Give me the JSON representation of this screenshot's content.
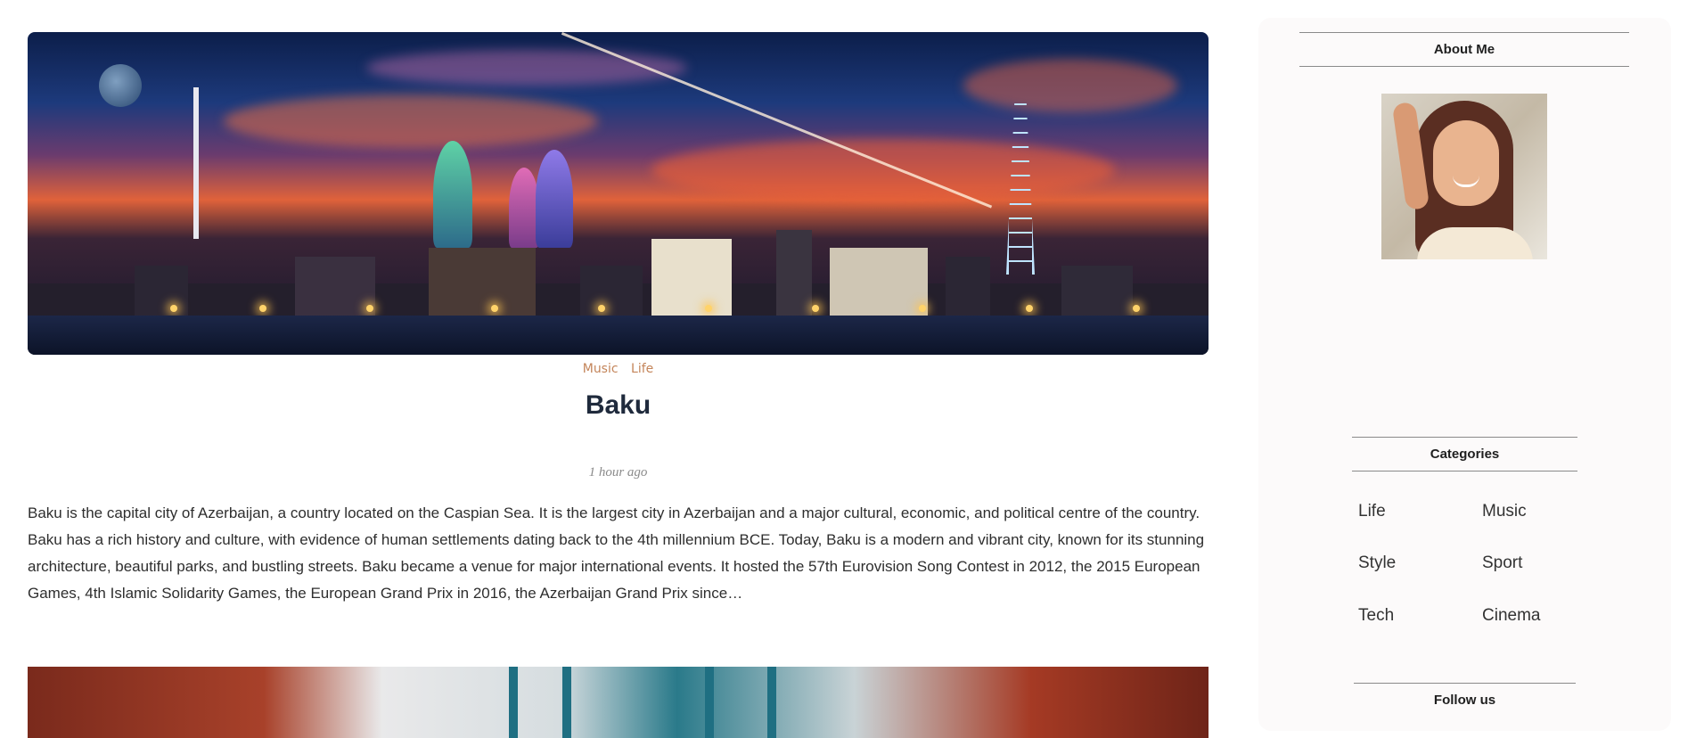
{
  "post": {
    "tags": [
      "Music",
      "Life"
    ],
    "title": "Baku",
    "time": "1 hour ago",
    "excerpt": "Baku is the capital city of Azerbaijan, a country located on the Caspian Sea. It is the largest city in Azerbaijan and a major cultural, economic, and political centre of the country. Baku has a rich history and culture, with evidence of human settlements dating back to the 4th millennium BCE. Today, Baku is a modern and vibrant city, known for its stunning architecture, beautiful parks, and bustling streets. Baku became a venue for major international events. It hosted the 57th Eurovision Song Contest in 2012, the 2015 European Games, 4th Islamic Solidarity Games, the European Grand Prix in 2016, the Azerbaijan Grand Prix since…"
  },
  "sidebar": {
    "about_title": "About Me",
    "categories_title": "Categories",
    "categories": [
      "Life",
      "Music",
      "Style",
      "Sport",
      "Tech",
      "Cinema"
    ],
    "follow_title": "Follow us"
  }
}
